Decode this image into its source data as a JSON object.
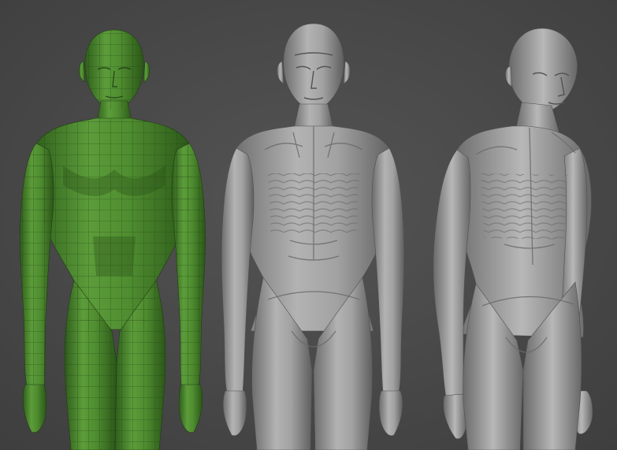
{
  "scene": {
    "description_visible_text": "",
    "background_color": "#4a4a4a",
    "models": [
      {
        "name": "base-mesh-figure",
        "material_color": "#4c8a2e",
        "wireframe": true
      },
      {
        "name": "sculpted-figure-front",
        "material_color": "#9a9a9a",
        "wireframe": false
      },
      {
        "name": "sculpted-figure-three-quarter",
        "material_color": "#a0a0a0",
        "wireframe": false
      }
    ]
  }
}
